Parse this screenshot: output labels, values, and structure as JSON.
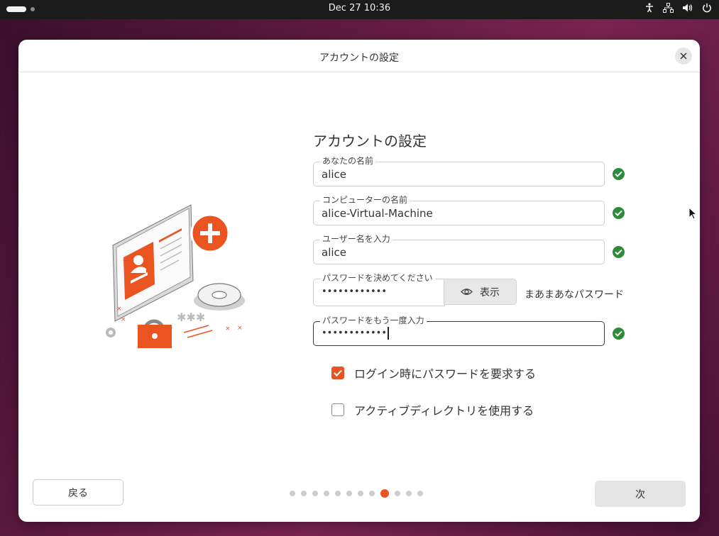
{
  "topbar": {
    "clock": "Dec 27  10:36"
  },
  "window": {
    "title": "アカウントの設定",
    "heading": "アカウントの設定",
    "fields": {
      "your_name": {
        "label": "あなたの名前",
        "value": "alice"
      },
      "computer_name": {
        "label": "コンピューターの名前",
        "value": "alice-Virtual-Machine"
      },
      "username": {
        "label": "ユーザー名を入力",
        "value": "alice"
      },
      "password": {
        "label": "パスワードを決めてください",
        "value": "••••••••••••"
      },
      "password_confirm": {
        "label": "パスワードをもう一度入力",
        "value": "••••••••••••"
      }
    },
    "show_button": "表示",
    "password_strength": "まあまあなパスワード",
    "checkboxes": {
      "require_password": {
        "label": "ログイン時にパスワードを要求する",
        "checked": true
      },
      "active_directory": {
        "label": "アクティブディレクトリを使用する",
        "checked": false
      }
    },
    "back_button": "戻る",
    "next_button": "次",
    "pager": {
      "total": 12,
      "current": 9
    }
  },
  "colors": {
    "accent": "#e95420",
    "valid": "#2e8b3a"
  }
}
